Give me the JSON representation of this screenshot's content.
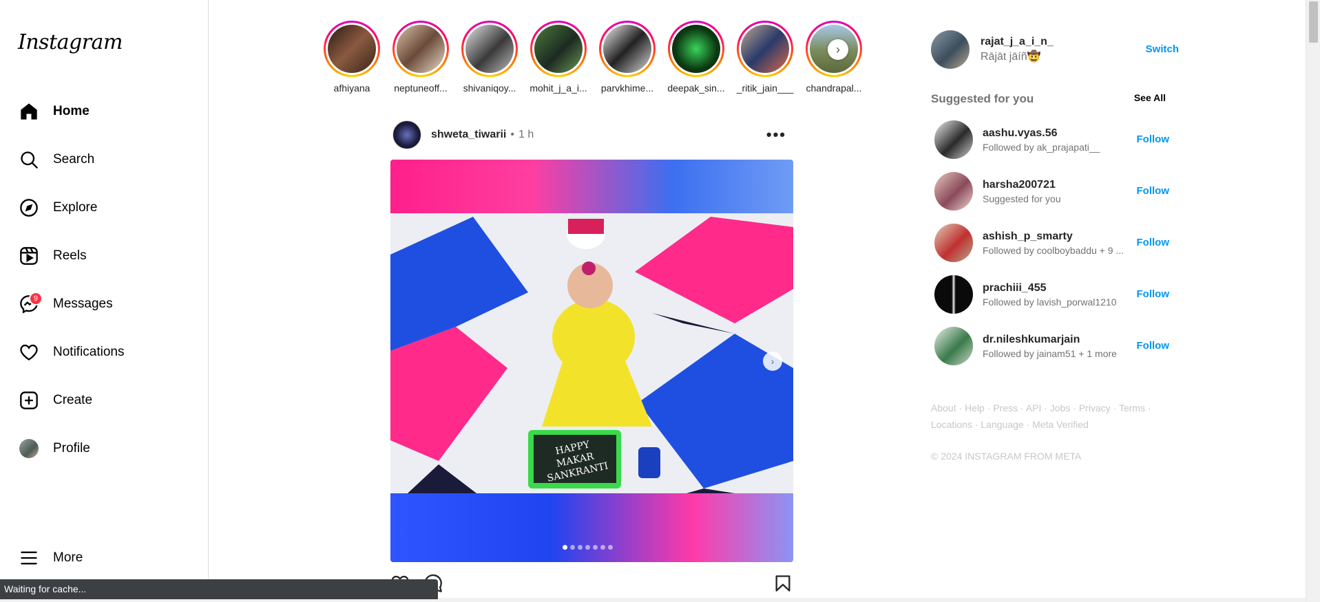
{
  "sidebar": {
    "logo": "Instagram",
    "items": [
      {
        "label": "Home",
        "icon": "home-icon"
      },
      {
        "label": "Search",
        "icon": "search-icon"
      },
      {
        "label": "Explore",
        "icon": "explore-icon"
      },
      {
        "label": "Reels",
        "icon": "reels-icon"
      },
      {
        "label": "Messages",
        "icon": "messages-icon",
        "badge": "9"
      },
      {
        "label": "Notifications",
        "icon": "heart-icon"
      },
      {
        "label": "Create",
        "icon": "create-icon"
      },
      {
        "label": "Profile",
        "icon": "avatar"
      },
      {
        "label": "More",
        "icon": "menu-icon"
      }
    ]
  },
  "stories": [
    {
      "name": "afhiyana"
    },
    {
      "name": "neptuneoff..."
    },
    {
      "name": "shivaniqoy..."
    },
    {
      "name": "mohit_j_a_i..."
    },
    {
      "name": "parvkhime..."
    },
    {
      "name": "deepak_sin..."
    },
    {
      "name": "_ritik_jain___"
    },
    {
      "name": "chandrapal..."
    }
  ],
  "post": {
    "username": "shweta_tiwarii",
    "separator": "•",
    "time": "1 h",
    "image_text": "HAPPY MAKAR SANKRANTI",
    "slide_count": 7,
    "active_slide": 1
  },
  "current_user": {
    "username": "rajat_j_a_i_n_",
    "display_name": "Rājāt jāíñ🤠",
    "switch_label": "Switch"
  },
  "suggestions": {
    "title": "Suggested for you",
    "see_all": "See All",
    "follow_label": "Follow",
    "items": [
      {
        "username": "aashu.vyas.56",
        "subtitle": "Followed by ak_prajapati__"
      },
      {
        "username": "harsha200721",
        "subtitle": "Suggested for you"
      },
      {
        "username": "ashish_p_smarty",
        "subtitle": "Followed by coolboybaddu + 9 ..."
      },
      {
        "username": "prachiii_455",
        "subtitle": "Followed by lavish_porwal1210"
      },
      {
        "username": "dr.nileshkumarjain",
        "subtitle": "Followed by jainam51 + 1 more"
      }
    ]
  },
  "footer": {
    "links": [
      "About",
      "Help",
      "Press",
      "API",
      "Jobs",
      "Privacy",
      "Terms",
      "Locations",
      "Language",
      "Meta Verified"
    ],
    "copyright": "© 2024 INSTAGRAM FROM META"
  },
  "status_bar": "Waiting for cache...",
  "colors": {
    "accent": "#0095f6",
    "badge": "#ff3040",
    "muted": "#737373"
  }
}
